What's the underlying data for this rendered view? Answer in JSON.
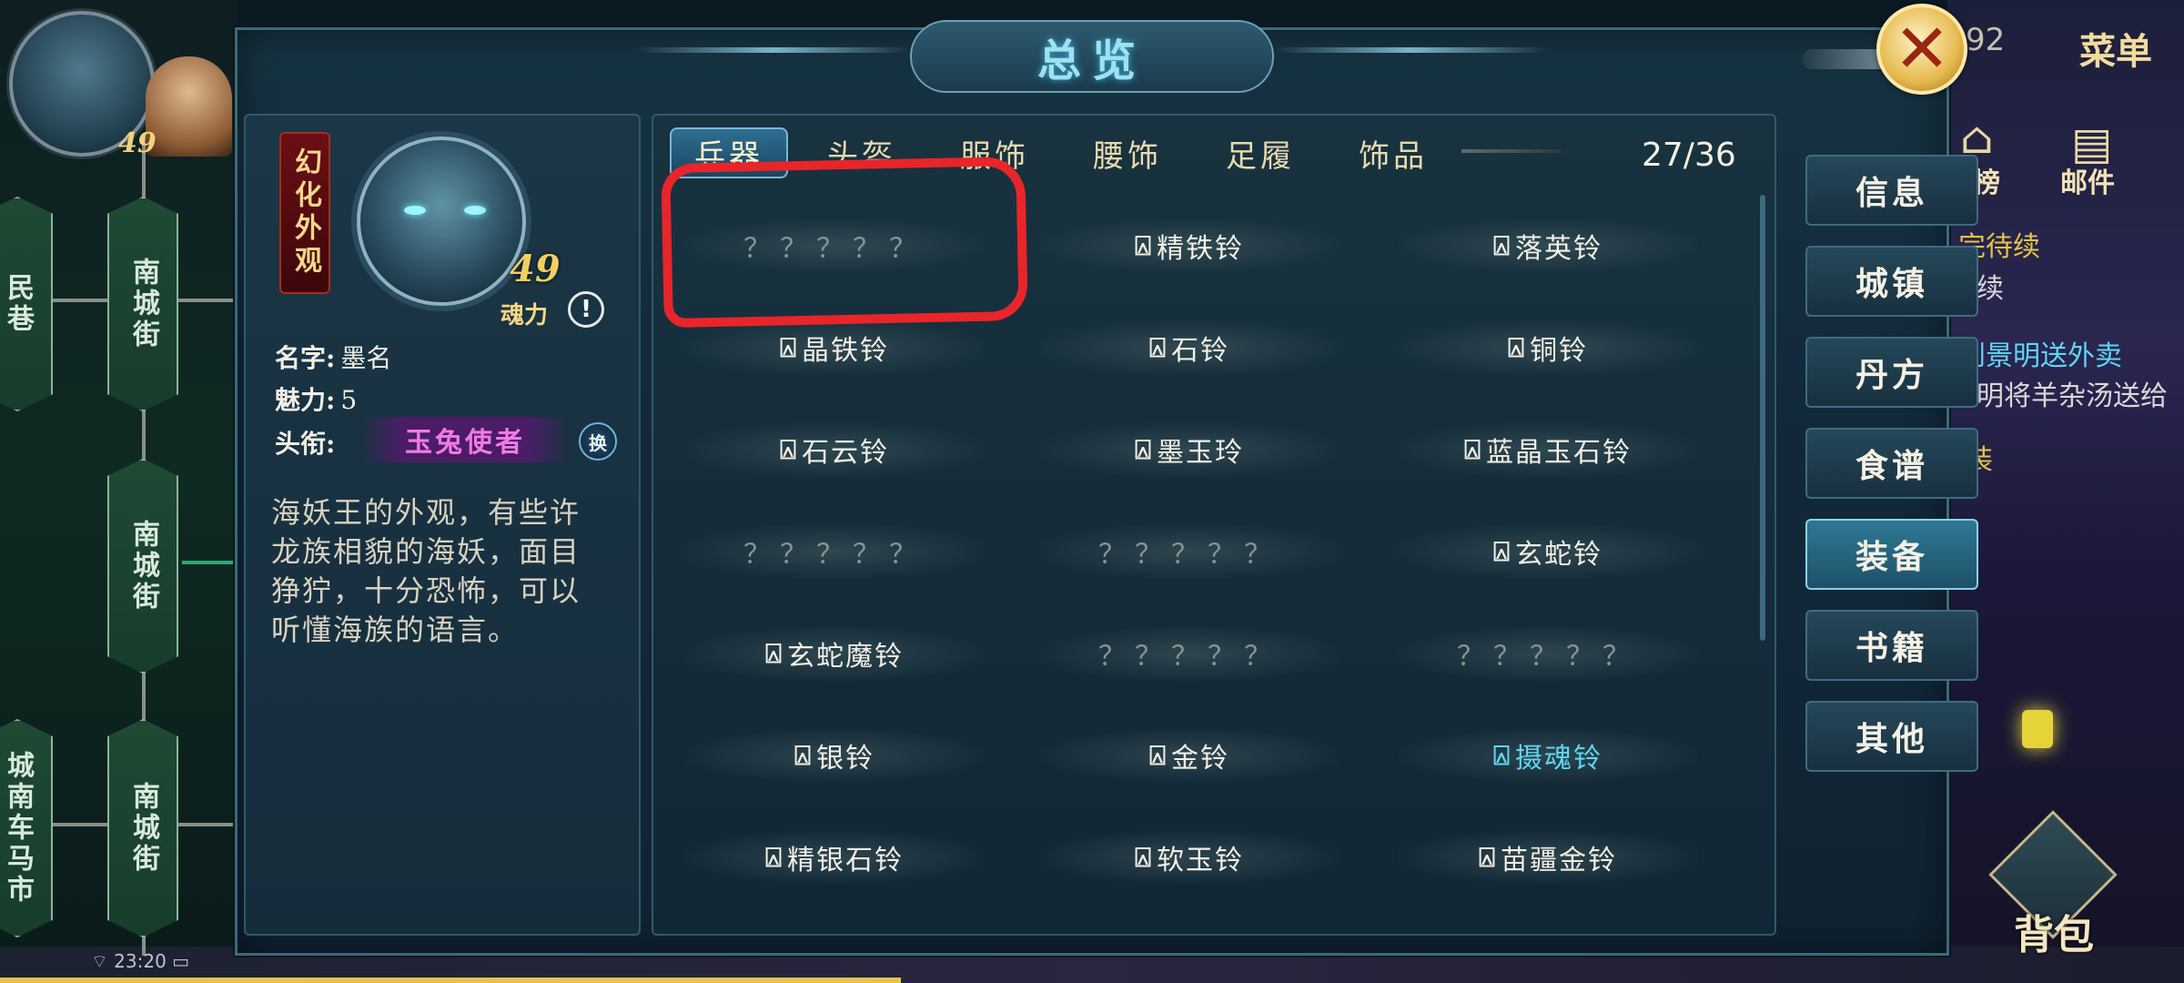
{
  "background": {
    "streets": [
      {
        "label": "民巷"
      },
      {
        "label": "南城街"
      },
      {
        "label": "南城街"
      },
      {
        "label": "城南车马市"
      },
      {
        "label": "南城街"
      }
    ],
    "top_level": "49",
    "top_small_tag": "4",
    "status_time": "23:20",
    "top_right_number": "92",
    "menu_label": "菜单",
    "leaderboard_label": "榜",
    "mail_label": "邮件",
    "quest_lines": [
      "完待续",
      "续",
      "到景明送外卖",
      "明将羊杂汤送给",
      "装"
    ],
    "bag_label": "背包"
  },
  "panel": {
    "title": "总览",
    "close_icon": "close-icon"
  },
  "character": {
    "banner": "幻化外观",
    "level": "49",
    "soul_label": "魂力",
    "alert_symbol": "!",
    "name_label": "名字:",
    "name_value": "墨名",
    "charm_label": "魅力:",
    "charm_value": "5",
    "title_label": "头衔:",
    "title_value": "玉兔使者",
    "swap_label": "换",
    "description": "海妖王的外观，有些许龙族相貌的海妖，面目狰狞，十分恐怖，可以听懂海族的语言。"
  },
  "tabs": [
    {
      "label": "兵器",
      "active": true
    },
    {
      "label": "头盔",
      "active": false
    },
    {
      "label": "服饰",
      "active": false
    },
    {
      "label": "腰饰",
      "active": false
    },
    {
      "label": "足履",
      "active": false
    },
    {
      "label": "饰品",
      "active": false
    }
  ],
  "count": "27/36",
  "bell_icon": "bell-icon",
  "grid": [
    [
      {
        "name": "？？？？？",
        "known": false
      },
      {
        "name": "精铁铃",
        "known": true
      },
      {
        "name": "落英铃",
        "known": true
      }
    ],
    [
      {
        "name": "晶铁铃",
        "known": true
      },
      {
        "name": "石铃",
        "known": true
      },
      {
        "name": "铜铃",
        "known": true
      }
    ],
    [
      {
        "name": "石云铃",
        "known": true
      },
      {
        "name": "墨玉玲",
        "known": true
      },
      {
        "name": "蓝晶玉石铃",
        "known": true
      }
    ],
    [
      {
        "name": "？？？？？",
        "known": false
      },
      {
        "name": "？？？？？",
        "known": false
      },
      {
        "name": "玄蛇铃",
        "known": true
      }
    ],
    [
      {
        "name": "玄蛇魔铃",
        "known": true
      },
      {
        "name": "？？？？？",
        "known": false
      },
      {
        "name": "？？？？？",
        "known": false
      }
    ],
    [
      {
        "name": "银铃",
        "known": true
      },
      {
        "name": "金铃",
        "known": true
      },
      {
        "name": "摄魂铃",
        "known": true,
        "rare": true
      }
    ],
    [
      {
        "name": "精银石铃",
        "known": true
      },
      {
        "name": "软玉铃",
        "known": true
      },
      {
        "name": "苗疆金铃",
        "known": true
      }
    ]
  ],
  "side_menu": [
    {
      "label": "信息",
      "active": false
    },
    {
      "label": "城镇",
      "active": false
    },
    {
      "label": "丹方",
      "active": false
    },
    {
      "label": "食谱",
      "active": false
    },
    {
      "label": "装备",
      "active": true
    },
    {
      "label": "书籍",
      "active": false
    },
    {
      "label": "其他",
      "active": false
    }
  ],
  "colors": {
    "rare_item": "#5fd7f2",
    "unknown_item": "#8a938f",
    "highlight": "#e8252a",
    "title_badge_text": "#f07ae6"
  }
}
